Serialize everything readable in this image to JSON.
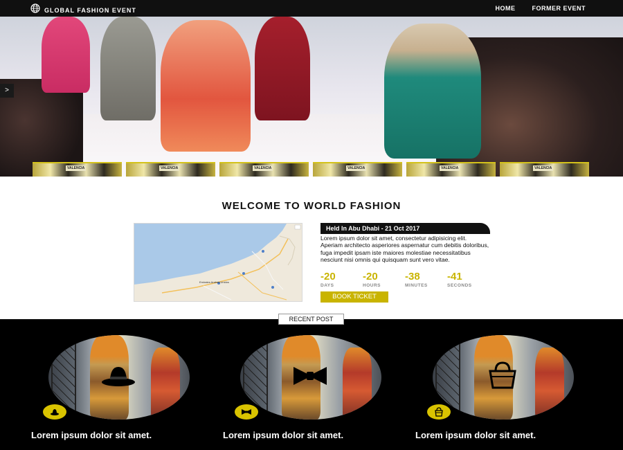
{
  "nav": {
    "brand": "GLOBAL FASHION EVENT",
    "links": [
      "HOME",
      "FORMER EVENT"
    ]
  },
  "hero": {
    "arrow_label": ">",
    "thumbnails": [
      {
        "label": "VALENCIA"
      },
      {
        "label": "VALENCIA"
      },
      {
        "label": "VALENCIA"
      },
      {
        "label": "VALENCIA"
      },
      {
        "label": "VALENCIA"
      },
      {
        "label": "VALENCIA"
      }
    ]
  },
  "welcome": {
    "title": "WELCOME TO WORLD FASHION",
    "map_label": "Emirates Arabes Unidos",
    "event_heading": "Held In Abu Dhabi - 21 Oct 2017",
    "description": "Lorem ipsum dolor sit amet, consectetur adipisicing elit. Aperiam architecto asperiores aspernatur cum debitis doloribus, fuga impedit ipsam iste maiores molestiae necessitatibus nesciunt nisi omnis qui quisquam sunt vero vitae.",
    "countdown": [
      {
        "value": "-20",
        "label": "DAYS"
      },
      {
        "value": "-20",
        "label": "HOURS"
      },
      {
        "value": "-38",
        "label": "MINUTES"
      },
      {
        "value": "-41",
        "label": "SECONDS"
      }
    ],
    "book_button": "BOOK TICKET"
  },
  "recent": {
    "tab_label": "RECENT POST",
    "posts": [
      {
        "title": "Lorem ipsum dolor sit amet.",
        "icon": "hat-icon"
      },
      {
        "title": "Lorem ipsum dolor sit amet.",
        "icon": "bowtie-icon"
      },
      {
        "title": "Lorem ipsum dolor sit amet.",
        "icon": "handbag-icon"
      }
    ]
  },
  "colors": {
    "accent": "#c9b400",
    "dark": "#000000"
  }
}
